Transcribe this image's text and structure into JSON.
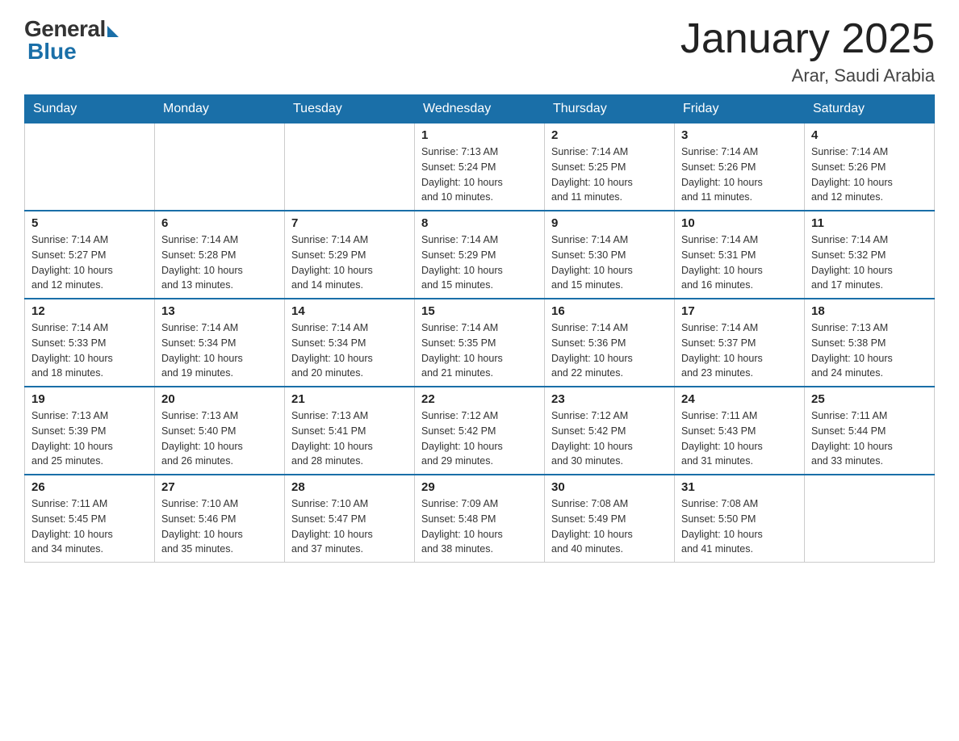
{
  "logo": {
    "general": "General",
    "blue": "Blue"
  },
  "title": "January 2025",
  "subtitle": "Arar, Saudi Arabia",
  "days_of_week": [
    "Sunday",
    "Monday",
    "Tuesday",
    "Wednesday",
    "Thursday",
    "Friday",
    "Saturday"
  ],
  "weeks": [
    [
      {
        "day": "",
        "info": ""
      },
      {
        "day": "",
        "info": ""
      },
      {
        "day": "",
        "info": ""
      },
      {
        "day": "1",
        "info": "Sunrise: 7:13 AM\nSunset: 5:24 PM\nDaylight: 10 hours\nand 10 minutes."
      },
      {
        "day": "2",
        "info": "Sunrise: 7:14 AM\nSunset: 5:25 PM\nDaylight: 10 hours\nand 11 minutes."
      },
      {
        "day": "3",
        "info": "Sunrise: 7:14 AM\nSunset: 5:26 PM\nDaylight: 10 hours\nand 11 minutes."
      },
      {
        "day": "4",
        "info": "Sunrise: 7:14 AM\nSunset: 5:26 PM\nDaylight: 10 hours\nand 12 minutes."
      }
    ],
    [
      {
        "day": "5",
        "info": "Sunrise: 7:14 AM\nSunset: 5:27 PM\nDaylight: 10 hours\nand 12 minutes."
      },
      {
        "day": "6",
        "info": "Sunrise: 7:14 AM\nSunset: 5:28 PM\nDaylight: 10 hours\nand 13 minutes."
      },
      {
        "day": "7",
        "info": "Sunrise: 7:14 AM\nSunset: 5:29 PM\nDaylight: 10 hours\nand 14 minutes."
      },
      {
        "day": "8",
        "info": "Sunrise: 7:14 AM\nSunset: 5:29 PM\nDaylight: 10 hours\nand 15 minutes."
      },
      {
        "day": "9",
        "info": "Sunrise: 7:14 AM\nSunset: 5:30 PM\nDaylight: 10 hours\nand 15 minutes."
      },
      {
        "day": "10",
        "info": "Sunrise: 7:14 AM\nSunset: 5:31 PM\nDaylight: 10 hours\nand 16 minutes."
      },
      {
        "day": "11",
        "info": "Sunrise: 7:14 AM\nSunset: 5:32 PM\nDaylight: 10 hours\nand 17 minutes."
      }
    ],
    [
      {
        "day": "12",
        "info": "Sunrise: 7:14 AM\nSunset: 5:33 PM\nDaylight: 10 hours\nand 18 minutes."
      },
      {
        "day": "13",
        "info": "Sunrise: 7:14 AM\nSunset: 5:34 PM\nDaylight: 10 hours\nand 19 minutes."
      },
      {
        "day": "14",
        "info": "Sunrise: 7:14 AM\nSunset: 5:34 PM\nDaylight: 10 hours\nand 20 minutes."
      },
      {
        "day": "15",
        "info": "Sunrise: 7:14 AM\nSunset: 5:35 PM\nDaylight: 10 hours\nand 21 minutes."
      },
      {
        "day": "16",
        "info": "Sunrise: 7:14 AM\nSunset: 5:36 PM\nDaylight: 10 hours\nand 22 minutes."
      },
      {
        "day": "17",
        "info": "Sunrise: 7:14 AM\nSunset: 5:37 PM\nDaylight: 10 hours\nand 23 minutes."
      },
      {
        "day": "18",
        "info": "Sunrise: 7:13 AM\nSunset: 5:38 PM\nDaylight: 10 hours\nand 24 minutes."
      }
    ],
    [
      {
        "day": "19",
        "info": "Sunrise: 7:13 AM\nSunset: 5:39 PM\nDaylight: 10 hours\nand 25 minutes."
      },
      {
        "day": "20",
        "info": "Sunrise: 7:13 AM\nSunset: 5:40 PM\nDaylight: 10 hours\nand 26 minutes."
      },
      {
        "day": "21",
        "info": "Sunrise: 7:13 AM\nSunset: 5:41 PM\nDaylight: 10 hours\nand 28 minutes."
      },
      {
        "day": "22",
        "info": "Sunrise: 7:12 AM\nSunset: 5:42 PM\nDaylight: 10 hours\nand 29 minutes."
      },
      {
        "day": "23",
        "info": "Sunrise: 7:12 AM\nSunset: 5:42 PM\nDaylight: 10 hours\nand 30 minutes."
      },
      {
        "day": "24",
        "info": "Sunrise: 7:11 AM\nSunset: 5:43 PM\nDaylight: 10 hours\nand 31 minutes."
      },
      {
        "day": "25",
        "info": "Sunrise: 7:11 AM\nSunset: 5:44 PM\nDaylight: 10 hours\nand 33 minutes."
      }
    ],
    [
      {
        "day": "26",
        "info": "Sunrise: 7:11 AM\nSunset: 5:45 PM\nDaylight: 10 hours\nand 34 minutes."
      },
      {
        "day": "27",
        "info": "Sunrise: 7:10 AM\nSunset: 5:46 PM\nDaylight: 10 hours\nand 35 minutes."
      },
      {
        "day": "28",
        "info": "Sunrise: 7:10 AM\nSunset: 5:47 PM\nDaylight: 10 hours\nand 37 minutes."
      },
      {
        "day": "29",
        "info": "Sunrise: 7:09 AM\nSunset: 5:48 PM\nDaylight: 10 hours\nand 38 minutes."
      },
      {
        "day": "30",
        "info": "Sunrise: 7:08 AM\nSunset: 5:49 PM\nDaylight: 10 hours\nand 40 minutes."
      },
      {
        "day": "31",
        "info": "Sunrise: 7:08 AM\nSunset: 5:50 PM\nDaylight: 10 hours\nand 41 minutes."
      },
      {
        "day": "",
        "info": ""
      }
    ]
  ]
}
